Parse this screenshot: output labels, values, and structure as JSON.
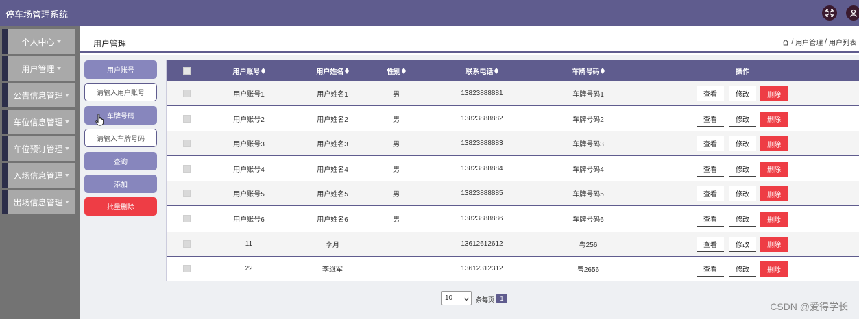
{
  "app": {
    "title": "停车场管理系统"
  },
  "sidebar": {
    "items": [
      {
        "label": "个人中心"
      },
      {
        "label": "用户管理"
      },
      {
        "label": "公告信息管理"
      },
      {
        "label": "车位信息管理"
      },
      {
        "label": "车位预订管理"
      },
      {
        "label": "入场信息管理"
      },
      {
        "label": "出场信息管理"
      }
    ]
  },
  "header": {
    "page_title": "用户管理",
    "breadcrumb": [
      "用户管理",
      "用户列表"
    ],
    "breadcrumb_sep": "/"
  },
  "filters": {
    "account_label": "用户账号",
    "account_placeholder": "请输入用户账号",
    "plate_label": "车牌号码",
    "plate_placeholder": "请输入车牌号码",
    "query": "查询",
    "add": "添加",
    "batch_delete": "批量删除"
  },
  "table": {
    "columns": [
      "用户账号",
      "用户姓名",
      "性别",
      "联系电话",
      "车牌号码",
      "操作"
    ],
    "actions": {
      "view": "查看",
      "edit": "修改",
      "delete": "删除"
    },
    "rows": [
      {
        "account": "用户账号1",
        "name": "用户姓名1",
        "gender": "男",
        "phone": "13823888881",
        "plate": "车牌号码1"
      },
      {
        "account": "用户账号2",
        "name": "用户姓名2",
        "gender": "男",
        "phone": "13823888882",
        "plate": "车牌号码2"
      },
      {
        "account": "用户账号3",
        "name": "用户姓名3",
        "gender": "男",
        "phone": "13823888883",
        "plate": "车牌号码3"
      },
      {
        "account": "用户账号4",
        "name": "用户姓名4",
        "gender": "男",
        "phone": "13823888884",
        "plate": "车牌号码4"
      },
      {
        "account": "用户账号5",
        "name": "用户姓名5",
        "gender": "男",
        "phone": "13823888885",
        "plate": "车牌号码5"
      },
      {
        "account": "用户账号6",
        "name": "用户姓名6",
        "gender": "男",
        "phone": "13823888886",
        "plate": "车牌号码6"
      },
      {
        "account": "11",
        "name": "李月",
        "gender": "",
        "phone": "13612612612",
        "plate": "粤256"
      },
      {
        "account": "22",
        "name": "李继军",
        "gender": "",
        "phone": "13612312312",
        "plate": "粤2656"
      }
    ]
  },
  "pagination": {
    "page_size": "10",
    "per_page_label": "条每页",
    "current_page": "1"
  },
  "watermark": "CSDN @爱得学长",
  "colors": {
    "primary": "#5f5c8e",
    "danger": "#ee3d45",
    "sidebar": "#737373",
    "sidebar_item": "#a9a9a9",
    "button": "#8786bd"
  }
}
